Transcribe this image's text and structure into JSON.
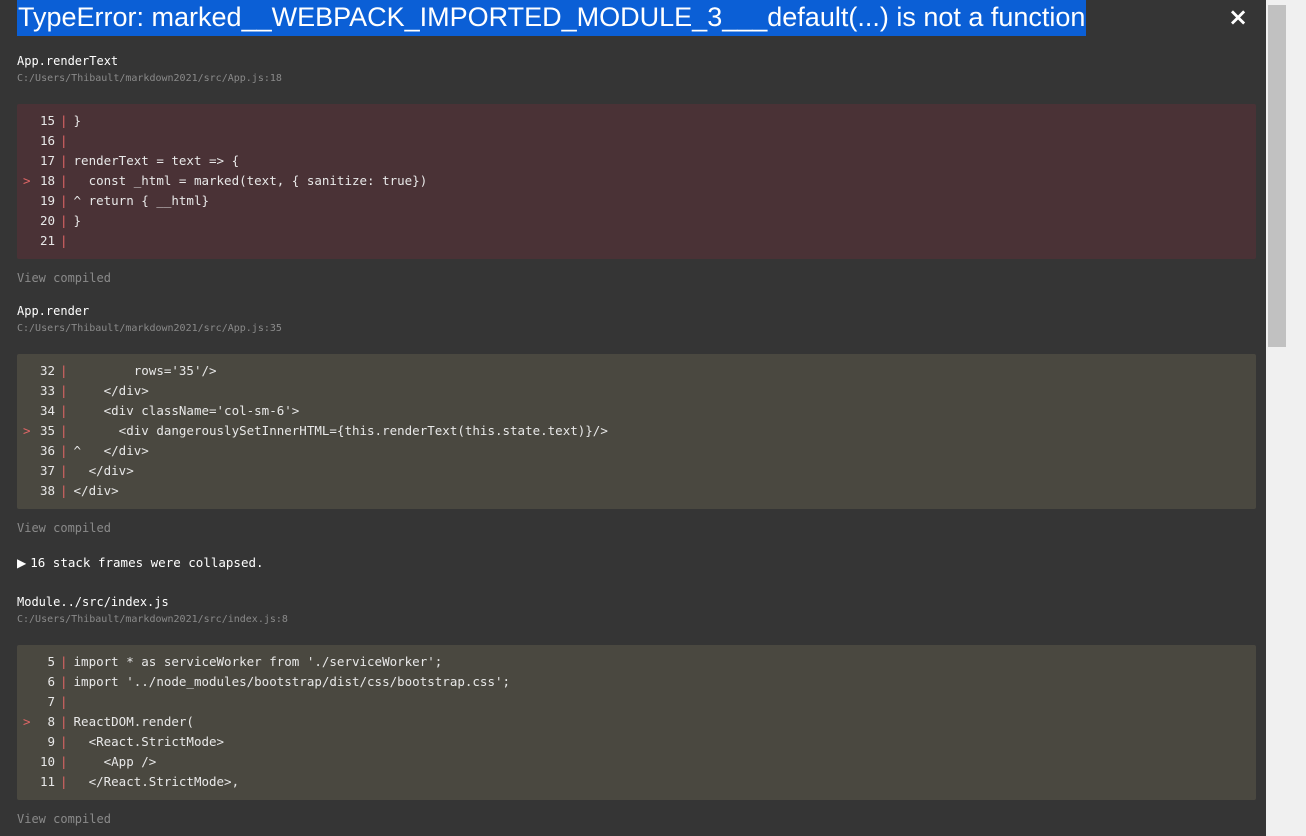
{
  "error": {
    "title": "TypeError: marked__WEBPACK_IMPORTED_MODULE_3___default(...) is not a function",
    "close_label": "×"
  },
  "frames": [
    {
      "function": "App.renderText",
      "location": "C:/Users/Thibault/markdown2021/src/App.js:18",
      "view_label": "View compiled",
      "lines": [
        {
          "marker": "",
          "num": "15",
          "text": "}"
        },
        {
          "marker": "",
          "num": "16",
          "text": ""
        },
        {
          "marker": "",
          "num": "17",
          "text": "renderText = text => {"
        },
        {
          "marker": ">",
          "num": "18",
          "text": "  const _html = marked(text, { sanitize: true})"
        },
        {
          "marker": "",
          "num": "19",
          "text": "^ return { __html}"
        },
        {
          "marker": "",
          "num": "20",
          "text": "}"
        },
        {
          "marker": "",
          "num": "21",
          "text": ""
        }
      ]
    },
    {
      "function": "App.render",
      "location": "C:/Users/Thibault/markdown2021/src/App.js:35",
      "view_label": "View compiled",
      "lines": [
        {
          "marker": "",
          "num": "32",
          "text": "        rows='35'/>"
        },
        {
          "marker": "",
          "num": "33",
          "text": "    </div>"
        },
        {
          "marker": "",
          "num": "34",
          "text": "    <div className='col-sm-6'>"
        },
        {
          "marker": ">",
          "num": "35",
          "text": "      <div dangerouslySetInnerHTML={this.renderText(this.state.text)}/>"
        },
        {
          "marker": "",
          "num": "36",
          "text": "^   </div>"
        },
        {
          "marker": "",
          "num": "37",
          "text": "  </div>"
        },
        {
          "marker": "",
          "num": "38",
          "text": "</div>"
        }
      ]
    },
    {
      "function": "Module../src/index.js",
      "location": "C:/Users/Thibault/markdown2021/src/index.js:8",
      "view_label": "View compiled",
      "lines": [
        {
          "marker": "",
          "num": "5",
          "text": "import * as serviceWorker from './serviceWorker';"
        },
        {
          "marker": "",
          "num": "6",
          "text": "import '../node_modules/bootstrap/dist/css/bootstrap.css';"
        },
        {
          "marker": "",
          "num": "7",
          "text": ""
        },
        {
          "marker": ">",
          "num": "8",
          "text": "ReactDOM.render("
        },
        {
          "marker": "",
          "num": "9",
          "text": "  <React.StrictMode>"
        },
        {
          "marker": "",
          "num": "10",
          "text": "    <App />"
        },
        {
          "marker": "",
          "num": "11",
          "text": "  </React.StrictMode>,"
        }
      ]
    }
  ],
  "collapsed": {
    "label": "16 stack frames were collapsed."
  }
}
